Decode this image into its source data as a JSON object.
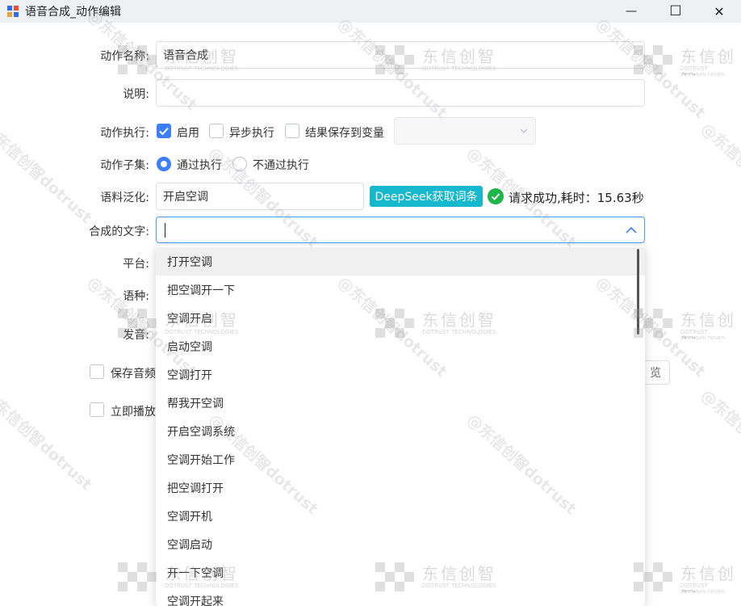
{
  "window": {
    "title": "语音合成_动作编辑",
    "controls": {
      "minimize": "—",
      "maximize": "☐",
      "close": "✕"
    }
  },
  "form": {
    "action_name": {
      "label": "动作名称:",
      "value": "语音合成"
    },
    "description": {
      "label": "说明:",
      "value": ""
    },
    "execution": {
      "label": "动作执行:",
      "enable": {
        "label": "启用",
        "checked": true
      },
      "async": {
        "label": "异步执行",
        "checked": false
      },
      "save_result": {
        "label": "结果保存到变量",
        "checked": false
      }
    },
    "sub_action": {
      "label": "动作子集:",
      "pass": {
        "label": "通过执行",
        "selected": true
      },
      "fail": {
        "label": "不通过执行",
        "selected": false
      }
    },
    "generalize": {
      "label": "语料泛化:",
      "value": "开启空调",
      "button": "DeepSeek获取词条",
      "status": "请求成功,耗时：15.63秒"
    },
    "synth_text": {
      "label": "合成的文字:",
      "value": ""
    },
    "platform": {
      "label": "平台:"
    },
    "language": {
      "label": "语种:"
    },
    "voice": {
      "label": "发音:"
    },
    "save_audio": {
      "label": "保存音频",
      "checked": false
    },
    "play_now": {
      "label": "立即播放",
      "checked": false
    },
    "preview_button": "览"
  },
  "dropdown": {
    "items": [
      "打开空调",
      "把空调开一下",
      "空调开启",
      "启动空调",
      "空调打开",
      "帮我开空调",
      "开启空调系统",
      "空调开始工作",
      "把空调打开",
      "空调开机",
      "空调启动",
      "开一下空调",
      "空调开起来"
    ]
  },
  "watermark": {
    "circle_text": "@东信创智dotrust",
    "logo_main": "东信创智",
    "logo_sub": "DOTRUST TECHNOLOGIES"
  },
  "colors": {
    "accent": "#3d7eff",
    "deepseek_button": "#15b8cc",
    "success": "#1fb548"
  }
}
